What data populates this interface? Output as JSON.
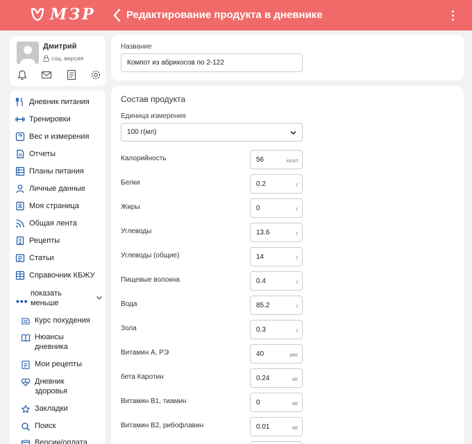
{
  "header": {
    "logo_text": "МЗР",
    "title": "Редактирование продукта в дневнике",
    "color": "#f06a6a"
  },
  "profile": {
    "name": "Дмитрий",
    "version": "соц. версия"
  },
  "nav": {
    "items": [
      {
        "label": "Дневник питания",
        "icon": "food-diary-icon"
      },
      {
        "label": "Тренировки",
        "icon": "dumbbell-icon"
      },
      {
        "label": "Вес и измерения",
        "icon": "scale-icon"
      },
      {
        "label": "Отчеты",
        "icon": "reports-icon"
      },
      {
        "label": "Планы питания",
        "icon": "meal-plans-icon"
      },
      {
        "label": "Личные данные",
        "icon": "person-icon"
      },
      {
        "label": "Моя страница",
        "icon": "page-icon"
      },
      {
        "label": "Общая лента",
        "icon": "feed-icon"
      },
      {
        "label": "Рецепты",
        "icon": "recipes-icon"
      },
      {
        "label": "Статьи",
        "icon": "articles-icon"
      },
      {
        "label": "Справочник КБЖУ",
        "icon": "reference-icon"
      }
    ],
    "more_label": "показать меньше",
    "sub_items": [
      {
        "label": "Курс похудения",
        "icon": "course-icon"
      },
      {
        "label": "Нюансы дневника",
        "icon": "book-icon"
      },
      {
        "label": "Мои рецепты",
        "icon": "my-recipes-icon"
      },
      {
        "label": "Дневник здоровья",
        "icon": "heart-icon"
      },
      {
        "label": "Закладки",
        "icon": "star-icon"
      },
      {
        "label": "Поиск",
        "icon": "search-icon"
      },
      {
        "label": "Версии/оплата",
        "icon": "payment-icon"
      }
    ]
  },
  "product": {
    "name_label": "Название",
    "name_value": "Компот из абрикосов по 2-122"
  },
  "composition": {
    "title": "Состав продукта",
    "unit_label": "Единица измерения",
    "unit_value": "100 г(мл)",
    "rows": [
      {
        "label": "Калорийность",
        "value": "56",
        "unit": "ккал"
      },
      {
        "label": "Белки",
        "value": "0.2",
        "unit": "г"
      },
      {
        "label": "Жиры",
        "value": "0",
        "unit": "г"
      },
      {
        "label": "Углеводы",
        "value": "13.6",
        "unit": "г"
      },
      {
        "label": "Углеводы (общие)",
        "value": "14",
        "unit": "г"
      },
      {
        "label": "Пищевые волокна",
        "value": "0.4",
        "unit": "г"
      },
      {
        "label": "Вода",
        "value": "85.2",
        "unit": "г"
      },
      {
        "label": "Зола",
        "value": "0.3",
        "unit": "г"
      },
      {
        "label": "Витамин А, РЭ",
        "value": "40",
        "unit": "мкг"
      },
      {
        "label": "бета Каротин",
        "value": "0.24",
        "unit": "мг"
      },
      {
        "label": "Витамин В1, тиамин",
        "value": "0",
        "unit": "мг"
      },
      {
        "label": "Витамин В2, рибофлавин",
        "value": "0.01",
        "unit": "мг"
      }
    ]
  }
}
